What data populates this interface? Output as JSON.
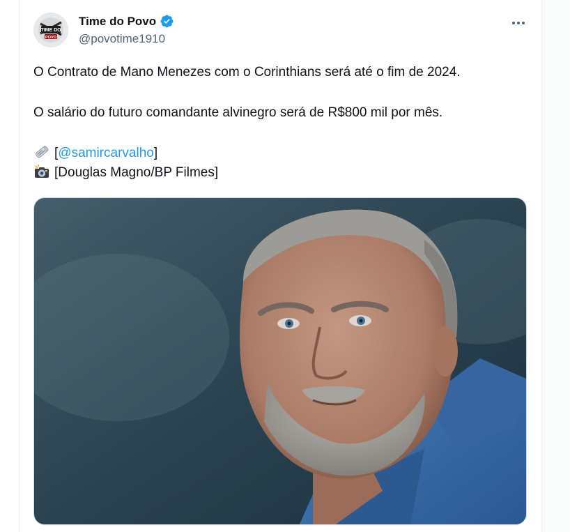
{
  "tweet": {
    "author_name": "Time do Povo",
    "handle": "@povotime1910",
    "avatar_text_top": "TIME DO",
    "avatar_text_bottom": "POVO",
    "paragraph_1": "O Contrato de Mano Menezes com o Corinthians será até o fim de 2024.",
    "paragraph_2": "O salário do futuro comandante alvinegro será de R$800 mil por mês.",
    "credit_1_open": "[",
    "credit_1_link": "@samircarvalho",
    "credit_1_close": "]",
    "credit_2": "[Douglas Magno/BP Filmes]",
    "more_label": "•••"
  },
  "icons": {
    "verified": "verified-badge-icon",
    "newspaper": "rolled-newspaper-emoji",
    "camera": "camera-flash-emoji",
    "more": "more-options-icon"
  },
  "colors": {
    "verified": "#1d9bf0",
    "link": "#1d9bf0",
    "secondary_text": "#536471",
    "primary_text": "#0f1419"
  }
}
